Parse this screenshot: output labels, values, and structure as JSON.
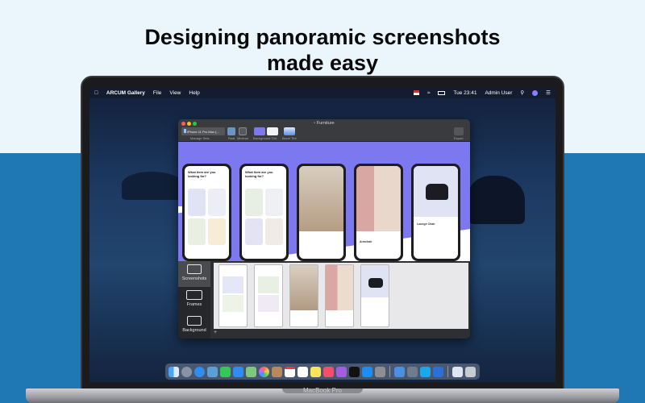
{
  "headline": {
    "line1": "Designing panoramic screenshots",
    "line2": "made easy"
  },
  "laptop": {
    "label": "MacBook Pro"
  },
  "menubar": {
    "app_name": "ARCUM Gallery",
    "menus": [
      "File",
      "View",
      "Help"
    ],
    "clock": "Tue 23:41",
    "user": "Admin User",
    "icons": [
      "apple-icon",
      "flag-icon",
      "wifi-icon",
      "battery-icon",
      "search-icon",
      "siri-icon",
      "list-icon"
    ]
  },
  "window": {
    "title": "Furniture",
    "toolbar": {
      "device_select": "iPhone 11 Pro Max (...",
      "manage_sets": "Manage Sets",
      "real": "Real",
      "minimal": "Minimal",
      "background_tint": "Background Tint",
      "bezel_tint": "Bezel Tint",
      "export": "Export"
    },
    "phone_headline": "What item are you looking for?",
    "phone_captions": [
      "Lounge Chair",
      "Armchair",
      "Lounge Chair",
      "Armchair"
    ],
    "phone_product": "Lounge Chair",
    "sidebar": {
      "screenshots": "Screenshots",
      "frames": "Frames",
      "background": "Background"
    }
  },
  "colors": {
    "background_top": "#eaf6fc",
    "background_bottom": "#1f78b4",
    "canvas_accent": "#7c78f0"
  },
  "dock": {
    "icons": [
      "finder-icon",
      "launchpad-icon",
      "safari-icon",
      "photos-icon",
      "messages-icon",
      "facetime-icon",
      "maps-icon",
      "photos2-icon",
      "contacts-icon",
      "calendar-icon",
      "notes-icon",
      "reminders-icon",
      "music-icon",
      "podcasts-icon",
      "tv-icon",
      "appstore-icon",
      "settings-icon",
      "arcum-icon",
      "screenshot-icon",
      "skype-icon",
      "sidebar-app-icon",
      "document-icon",
      "trash-icon"
    ]
  }
}
